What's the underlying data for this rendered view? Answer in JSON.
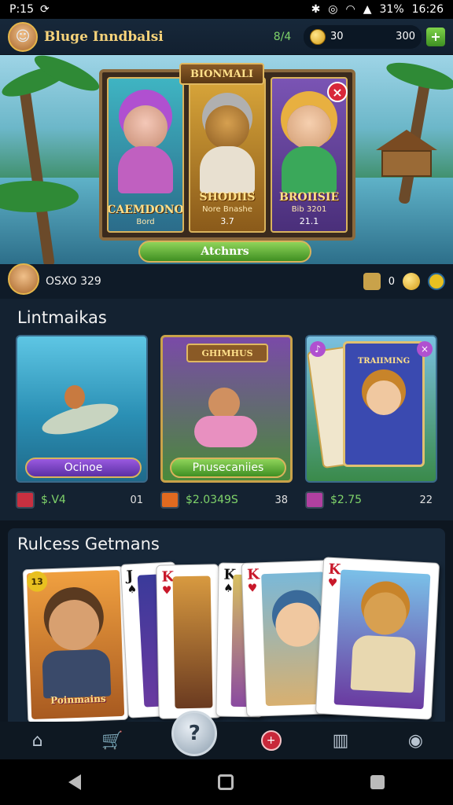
{
  "status_bar": {
    "time_left": "P:15",
    "battery": "31%",
    "clock": "16:26"
  },
  "header": {
    "title": "Bluge Inndbalsi",
    "level": "8/4",
    "coins_a": "30",
    "coins_b": "300",
    "plus": "+"
  },
  "hero": {
    "banner": "BIONMALI",
    "close": "×",
    "cards": [
      {
        "name": "CAEMDONO",
        "sub": "Bord",
        "stat": ""
      },
      {
        "name": "SHODIIS",
        "sub": "Nore Bnashe",
        "stat": "3.7"
      },
      {
        "name": "BROIISIE",
        "sub": "Bib 3201",
        "stat": "21.1"
      }
    ],
    "button": "Atchnrs"
  },
  "player": {
    "info": "OSXO 329",
    "count": "0"
  },
  "featured": {
    "title": "Lintmaikas",
    "tiles": [
      {
        "button": "Ocinoe",
        "price": "$.V4",
        "count": "01",
        "art_label": ""
      },
      {
        "button": "Pnusecaniies",
        "price": "$2.0349S",
        "count": "38",
        "art_label": "GHIMHUS"
      },
      {
        "button": "",
        "price": "$2.75",
        "count": "22",
        "art_label": "TRAIIMING"
      }
    ]
  },
  "cards_section": {
    "title": "Rulcess Getmans",
    "card_texts": [
      {
        "rank": "13",
        "caption": "Poinmains"
      },
      {
        "rank": "J",
        "caption": ""
      },
      {
        "rank": "K",
        "caption": ""
      },
      {
        "rank": "K",
        "caption": ""
      },
      {
        "rank": "K",
        "caption": ""
      },
      {
        "rank": "K",
        "caption": ""
      }
    ]
  },
  "nav": {
    "center": "?",
    "red": "+"
  },
  "colors": {
    "accent_gold": "#e5b64a",
    "green": "#7fd36a",
    "purple_button": "#7a3fc4",
    "green_button": "#4f9e2c"
  }
}
